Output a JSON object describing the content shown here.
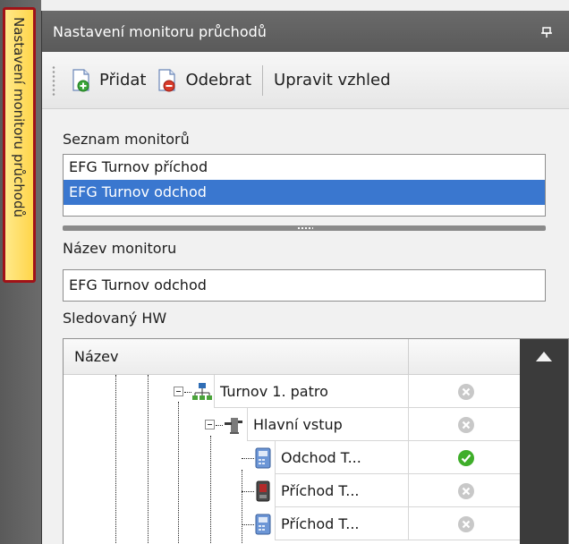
{
  "side_tab": {
    "label": "Nastavení monitoru průchodů"
  },
  "panel": {
    "title": "Nastavení monitoru průchodů",
    "pin_icon": "pin-icon"
  },
  "toolbar": {
    "add_label": "Přidat",
    "remove_label": "Odebrat",
    "edit_look_label": "Upravit vzhled"
  },
  "monitor_list": {
    "label": "Seznam monitorů",
    "items": [
      "EFG Turnov příchod",
      "EFG Turnov odchod"
    ],
    "selected_index": 1
  },
  "monitor_name": {
    "label": "Název monitoru",
    "value": "EFG Turnov odchod"
  },
  "hw": {
    "label": "Sledovaný HW",
    "column_name": "Název",
    "rows": [
      {
        "name": "Turnov 1. patro",
        "icon": "network-icon",
        "status": "inactive"
      },
      {
        "name": "Hlavní vstup",
        "icon": "turnstile-icon",
        "status": "inactive"
      },
      {
        "name": "Odchod T...",
        "icon": "reader-icon",
        "status": "active"
      },
      {
        "name": "Příchod T...",
        "icon": "terminal-icon",
        "status": "inactive"
      },
      {
        "name": "Příchod T...",
        "icon": "reader-icon",
        "status": "inactive"
      }
    ]
  },
  "colors": {
    "selection": "#3a77cf",
    "tab_highlight": "#ffd54a",
    "tab_border": "#a01218",
    "status_active": "#3fae2a",
    "status_inactive": "#c8c8c8"
  }
}
